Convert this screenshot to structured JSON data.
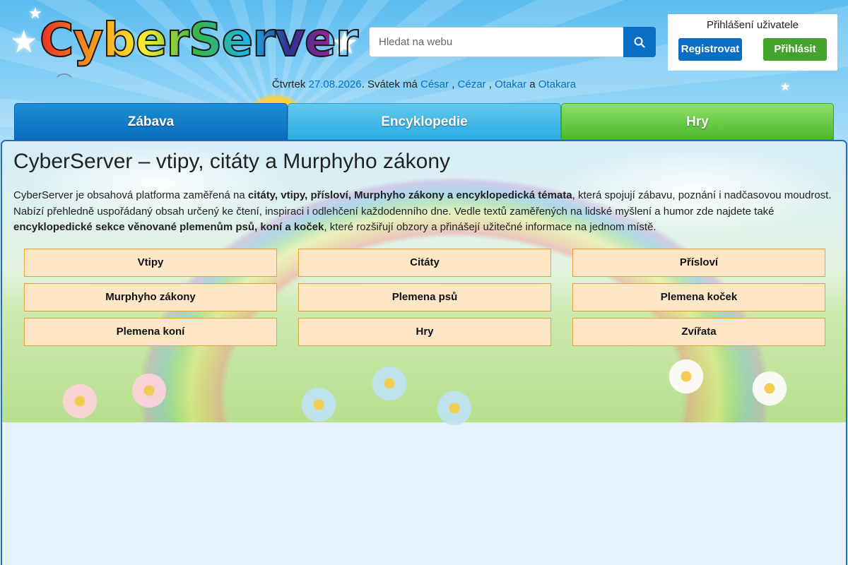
{
  "header": {
    "logo_text": "CyberServer",
    "search": {
      "placeholder": "Hledat na webu"
    },
    "login": {
      "title": "Přihlášení uživatele",
      "register_label": "Registrovat",
      "login_label": "Přihlásit"
    }
  },
  "date_line": {
    "day": "Čtvrtek",
    "date": "27.08.2026",
    "name_day_prefix": ". Svátek má",
    "names": [
      "César",
      "Cézar",
      "Otakar",
      "Otakara"
    ],
    "sep1": ",",
    "sep2": ",",
    "sep3": "a"
  },
  "tabs": [
    {
      "label": "Zábava"
    },
    {
      "label": "Encyklopedie"
    },
    {
      "label": "Hry"
    }
  ],
  "main": {
    "title": "CyberServer – vtipy, citáty a Murphyho zákony",
    "intro": {
      "p1": "CyberServer je obsahová platforma zaměřená na ",
      "b1": "citáty, vtipy, přísloví, Murphyho zákony a encyklopedická témata",
      "p2": ", která spojují zábavu, poznání i nadčasovou moudrost. Nabízí přehledně uspořádaný obsah určený ke čtení, inspiraci i odlehčení každodenního dne. Vedle textů zaměřených na lidské myšlení a humor zde najdete také ",
      "b2": "encyklopedické sekce věnované plemenům psů, koní a koček",
      "p3": ", které rozšiřují obzory a přinášejí užitečné informace na jednom místě."
    },
    "categories": [
      "Vtipy",
      "Citáty",
      "Přísloví",
      "Murphyho zákony",
      "Plemena psů",
      "Plemena koček",
      "Plemena koní",
      "Hry",
      "Zvířata"
    ]
  },
  "colors": {
    "primary_blue": "#0a6fc2",
    "green": "#43a32a",
    "category_bg": "#fde6c6",
    "category_border": "#e0a23a"
  },
  "icons": {
    "search": "search-icon"
  }
}
